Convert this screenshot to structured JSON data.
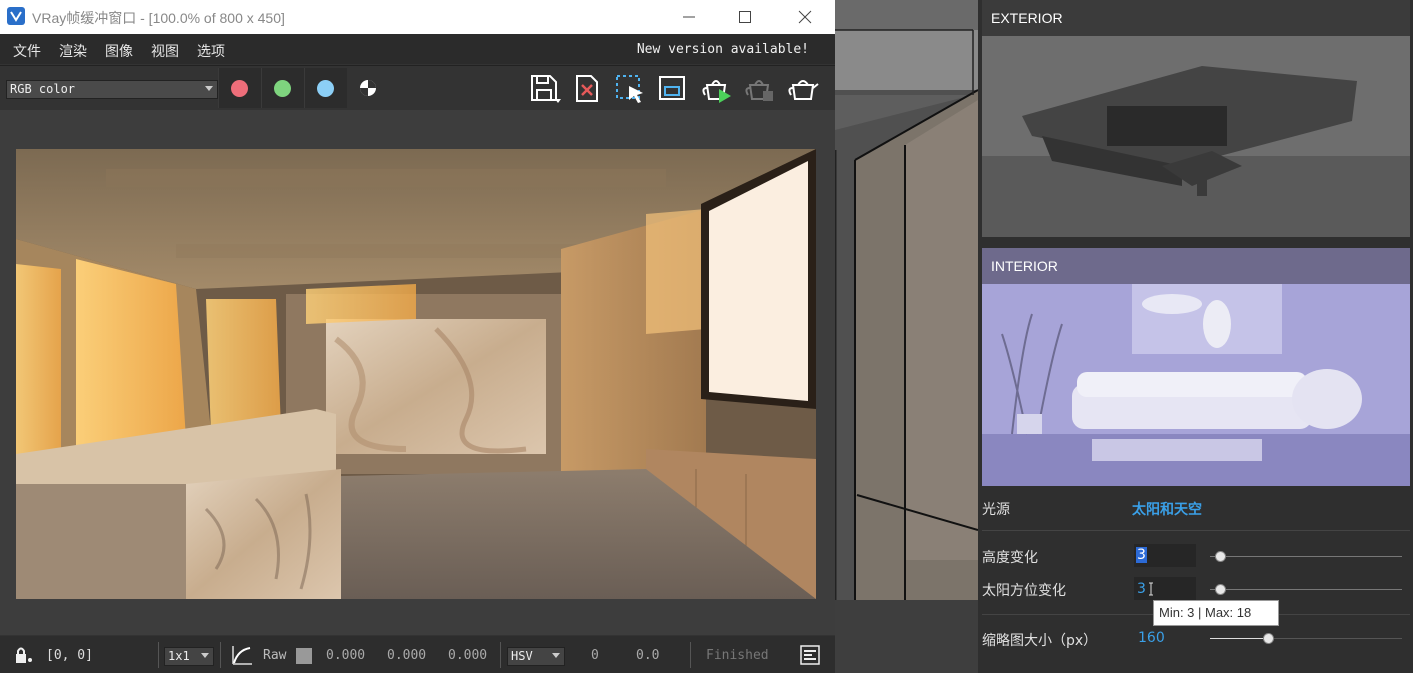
{
  "window": {
    "title": "VRay帧缓冲窗口 - [100.0% of 800 x 450]"
  },
  "menu": {
    "items": [
      "文件",
      "渲染",
      "图像",
      "视图",
      "选项"
    ],
    "notice": "New version available!"
  },
  "toolbar": {
    "channel": "RGB color",
    "red_color": "#ee6e7a",
    "green_color": "#7ed47e",
    "blue_color": "#8ccff6"
  },
  "status": {
    "coords": "[0, 0]",
    "sample": "1x1",
    "raw": "Raw",
    "r": "0.000",
    "g": "0.000",
    "b": "0.000",
    "colorspace": "HSV",
    "h": "0",
    "s": "0.0",
    "state": "Finished"
  },
  "panel": {
    "exterior": "EXTERIOR",
    "interior": "INTERIOR",
    "light_label": "光源",
    "light_value": "太阳和天空",
    "height_label": "高度变化",
    "height_value": "3",
    "height_level": 0.05,
    "azimuth_label": "太阳方位变化",
    "azimuth_value": "3",
    "azimuth_level": 0.05,
    "thumb_label": "缩略图大小（px）",
    "thumb_value": "160",
    "thumb_level": 0.3,
    "tooltip": "Min: 3 | Max: 18",
    "accent": "#3aa0e8"
  }
}
